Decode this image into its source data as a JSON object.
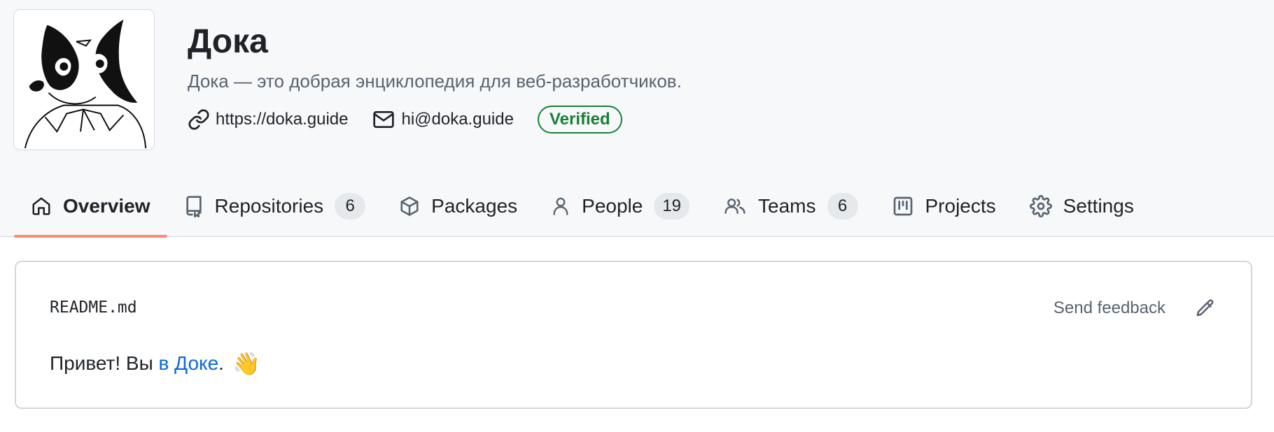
{
  "org": {
    "name": "Дока",
    "description": "Дока — это добрая энциклопедия для веб-разработчиков.",
    "website": "https://doka.guide",
    "email": "hi@doka.guide",
    "verified_label": "Verified",
    "avatar_icon": "doka-dog-logo"
  },
  "tabs": [
    {
      "label": "Overview",
      "icon": "home-icon",
      "selected": true
    },
    {
      "label": "Repositories",
      "icon": "repo-icon",
      "count": "6"
    },
    {
      "label": "Packages",
      "icon": "package-icon"
    },
    {
      "label": "People",
      "icon": "person-icon",
      "count": "19"
    },
    {
      "label": "Teams",
      "icon": "people-icon",
      "count": "6"
    },
    {
      "label": "Projects",
      "icon": "project-icon"
    },
    {
      "label": "Settings",
      "icon": "gear-icon"
    }
  ],
  "readme": {
    "filename": "README.md",
    "send_feedback": "Send feedback",
    "text_before": "Привет! Вы ",
    "link_text": "в Доке",
    "text_after": ".",
    "emoji": "👋"
  },
  "colors": {
    "accent_underline": "#fd8c73",
    "verified_green": "#1a7f37",
    "link_blue": "#0969da"
  }
}
